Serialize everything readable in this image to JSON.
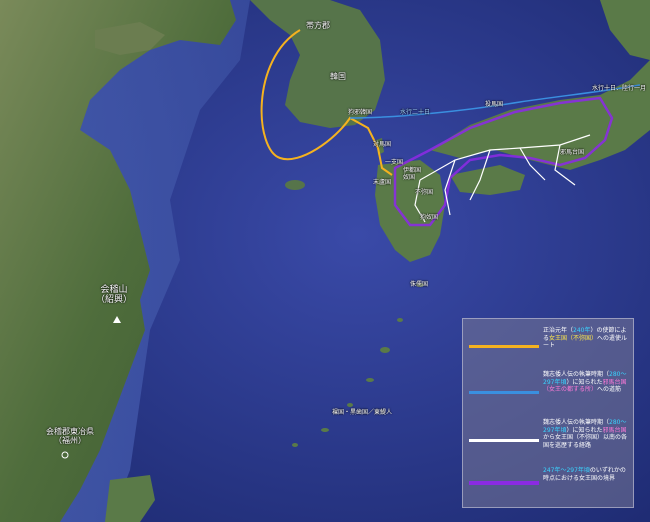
{
  "map": {
    "place_labels": {
      "daifang": "帯方郡",
      "hankuk": "韓国",
      "kuyakan": "狗邪韓国",
      "tsushima": "対馬国",
      "iki": "一支国",
      "matsuro": "末盧国",
      "ito": "伊都国",
      "na": "奴国",
      "fumi": "不弥国",
      "toma": "投馬国",
      "kuna": "狗奴国",
      "shuju": "侏儒国",
      "rakan": "裸国・黒歯国／東鯷人",
      "kaiji": "会稽山\n（紹興）",
      "dongye": "会稽郡東冶県\n（福州）",
      "suikou": "水行二十日",
      "suikou_riku": "水行十日、陸行一月",
      "yamatai": "邪馬台国"
    },
    "colors": {
      "ocean": "#2b3a8c",
      "land": "#4a6a3a",
      "kingdom_border": "#8a2be2",
      "yellow_route": "#f5b21f",
      "blue_route": "#3a8fe0",
      "white_route": "#ffffff"
    }
  },
  "legend": {
    "items": [
      {
        "line_color": "#f5b21f",
        "text_before": "正治元年（",
        "highlight_1": "240年",
        "text_mid": "）の使節による",
        "highlight_2": "女王国（不弥国）",
        "text_after": "への遣使ルート"
      },
      {
        "line_color": "#3a8fe0",
        "text_before": "魏志倭人伝の執筆時期（",
        "highlight_1": "280～297年頃",
        "text_mid": "）に知られた",
        "highlight_2": "邪馬台国（女王の都する所）",
        "text_after": "への道筋"
      },
      {
        "line_color": "#ffffff",
        "text_before": "魏志倭人伝の執筆時期（",
        "highlight_1": "280～297年頃",
        "text_mid": "）に知られた",
        "highlight_2": "邪馬台国",
        "text_after": "から女王国（不弥国）以南の各国を巡歴する経路"
      },
      {
        "line_color": "#8a2be2",
        "text_before": "",
        "highlight_1": "247年～297年頃",
        "text_mid": "の",
        "highlight_2": "",
        "text_after": "いずれかの時点における女王国の境界"
      }
    ]
  }
}
